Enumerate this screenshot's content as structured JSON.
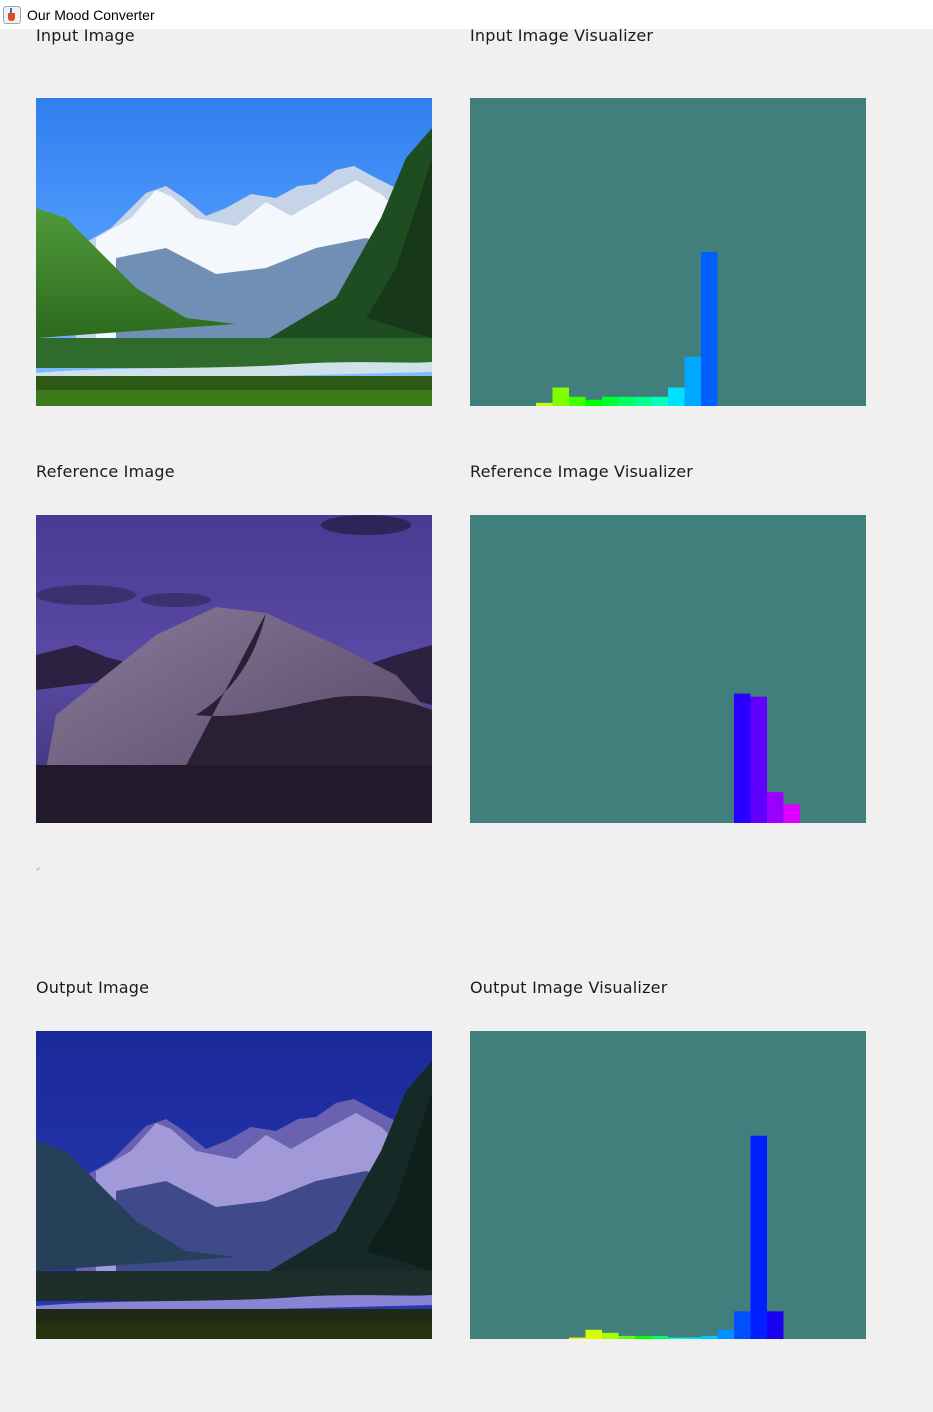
{
  "window": {
    "title": "Our Mood Converter",
    "icon": "java-coffee-icon"
  },
  "sections": {
    "input": {
      "image_label": "Input Image",
      "viz_label": "Input Image Visualizer"
    },
    "reference": {
      "image_label": "Reference Image",
      "viz_label": "Reference Image Visualizer"
    },
    "output": {
      "image_label": "Output Image",
      "viz_label": "Output Image Visualizer"
    }
  },
  "colors": {
    "visualizer_background": "#417f7c",
    "window_background": "#f0f0f0"
  },
  "chart_data": [
    {
      "type": "bar",
      "name": "input-histogram",
      "bins": 24,
      "ylim": [
        0,
        1
      ],
      "values": [
        0,
        0,
        0,
        0,
        0.01,
        0.06,
        0.03,
        0.02,
        0.03,
        0.03,
        0.03,
        0.03,
        0.06,
        0.16,
        0.5,
        0,
        0,
        0,
        0,
        0,
        0,
        0,
        0,
        0
      ],
      "colors": [
        "#ff0000",
        "#ff4000",
        "#ff8000",
        "#ffbf00",
        "#c8ff00",
        "#80ff00",
        "#40ff00",
        "#00ff00",
        "#00ff30",
        "#00ff60",
        "#00ff90",
        "#00ffc0",
        "#00e0ff",
        "#00a8ff",
        "#0060ff",
        "#0030ff",
        "#1000ff",
        "#3000ff",
        "#6000ff",
        "#9000ff",
        "#c000ff",
        "#ff00e0",
        "#ff0090",
        "#ff0040"
      ]
    },
    {
      "type": "bar",
      "name": "reference-histogram",
      "bins": 24,
      "ylim": [
        0,
        1
      ],
      "values": [
        0,
        0,
        0,
        0,
        0,
        0,
        0,
        0,
        0,
        0,
        0,
        0,
        0,
        0,
        0,
        0,
        0.42,
        0.41,
        0.1,
        0.06,
        0,
        0,
        0,
        0
      ],
      "colors": [
        "#ff0000",
        "#ff4000",
        "#ff8000",
        "#ffbf00",
        "#c8ff00",
        "#80ff00",
        "#40ff00",
        "#00ff00",
        "#00ff30",
        "#00ff60",
        "#00ff90",
        "#00ffc0",
        "#00e0ff",
        "#00a8ff",
        "#0060ff",
        "#0030ff",
        "#2800ff",
        "#6000ff",
        "#9a00ff",
        "#e000ff",
        "#ff00c0",
        "#ff0090",
        "#ff0040",
        "#ff0020"
      ]
    },
    {
      "type": "bar",
      "name": "output-histogram",
      "bins": 24,
      "ylim": [
        0,
        1
      ],
      "values": [
        0,
        0,
        0,
        0,
        0,
        0,
        0.005,
        0.03,
        0.02,
        0.01,
        0.01,
        0.01,
        0.005,
        0.005,
        0.01,
        0.03,
        0.09,
        0.66,
        0.09,
        0,
        0,
        0,
        0,
        0
      ],
      "colors": [
        "#ff0000",
        "#ff4000",
        "#ff8000",
        "#ffbf00",
        "#ffd000",
        "#ffff00",
        "#ffea00",
        "#d8ff00",
        "#a8ff00",
        "#60ff00",
        "#00ff00",
        "#00ff60",
        "#00ffc0",
        "#00e8ff",
        "#00c8ff",
        "#0090ff",
        "#0050ff",
        "#0020ff",
        "#1a00ee",
        "#5000ff",
        "#9000ff",
        "#ff00e0",
        "#ff0090",
        "#ff0040"
      ]
    }
  ]
}
